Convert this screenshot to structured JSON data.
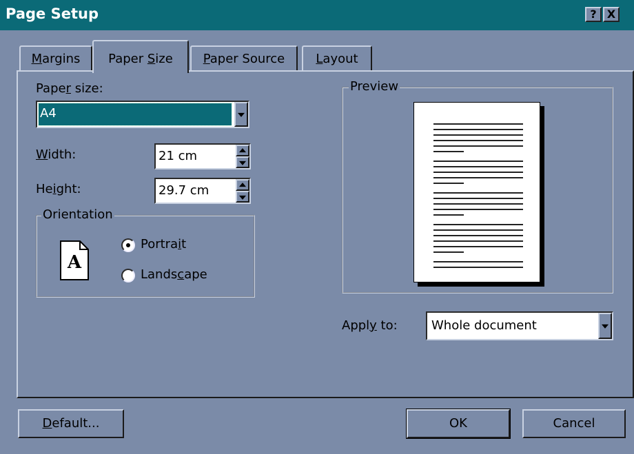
{
  "window": {
    "title": "Page Setup"
  },
  "titlebar_buttons": [
    {
      "label": "?",
      "icon": "help-icon"
    },
    {
      "label": "X",
      "icon": "close-icon"
    }
  ],
  "tabs": [
    {
      "label": "Margins",
      "u": "M",
      "rest": "argins",
      "active": false
    },
    {
      "label": "Paper Size",
      "pre": "Paper ",
      "u": "S",
      "rest": "ize",
      "active": true
    },
    {
      "label": "Paper Source",
      "u": "P",
      "rest": "aper Source",
      "active": false
    },
    {
      "label": "Layout",
      "u": "L",
      "rest": "ayout",
      "active": false
    }
  ],
  "paper": {
    "label_pre": "Pape",
    "label_u": "r",
    "label_rest": " size:",
    "value": "A4"
  },
  "width": {
    "label_u": "W",
    "label_rest": "idth:",
    "value": "21 cm"
  },
  "height": {
    "label_pre": "He",
    "label_u": "i",
    "label_rest": "ght:",
    "value": "29.7 cm"
  },
  "orientation": {
    "legend": "Orientation",
    "icon_letter": "A",
    "portrait": {
      "pre": "Portra",
      "u": "i",
      "rest": "t",
      "selected": true
    },
    "landscape": {
      "pre": "Lands",
      "u": "c",
      "rest": "ape",
      "selected": false
    }
  },
  "preview": {
    "legend": "Preview"
  },
  "apply_to": {
    "label_pre": "Appl",
    "label_u": "y",
    "label_rest": " to:",
    "value": "Whole document"
  },
  "buttons": {
    "default_u": "D",
    "default_rest": "efault...",
    "ok": "OK",
    "cancel": "Cancel"
  },
  "colors": {
    "titlebar": "#0b6a77",
    "face": "#7b8ba8",
    "selection": "#0b6a77"
  }
}
